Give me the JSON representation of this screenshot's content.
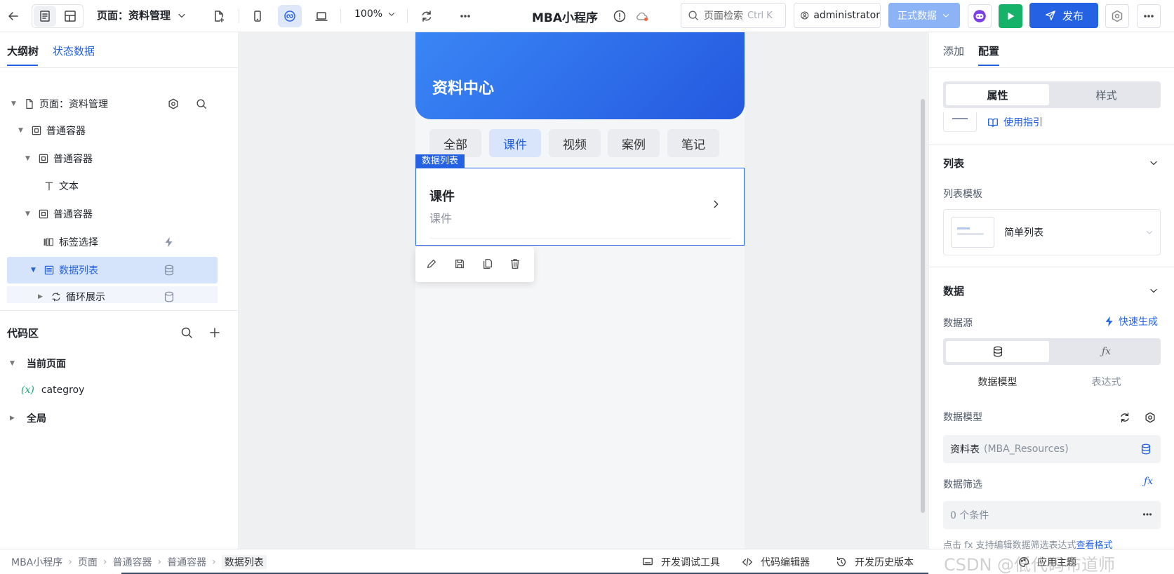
{
  "topbar": {
    "page_label": "页面：资料管理",
    "zoom": "100%",
    "app_title": "MBA小程序",
    "search_placeholder": "页面检索",
    "search_shortcut": "Ctrl K",
    "user": "administrator",
    "env_label": "正式数据",
    "publish_label": "发布"
  },
  "left": {
    "tabs": [
      "大纲树",
      "状态数据"
    ],
    "tree": [
      {
        "label": "页面：资料管理"
      },
      {
        "label": "普通容器"
      },
      {
        "label": "普通容器"
      },
      {
        "label": "文本"
      },
      {
        "label": "普通容器"
      },
      {
        "label": "标签选择"
      },
      {
        "label": "数据列表"
      },
      {
        "label": "循环展示"
      }
    ],
    "code_title": "代码区",
    "current_page": "当前页面",
    "variable": "categroy",
    "variable_prefix": "(x)",
    "global": "全局"
  },
  "canvas": {
    "header_title": "资料中心",
    "tags": [
      "全部",
      "课件",
      "视频",
      "案例",
      "笔记"
    ],
    "active_tag_index": 1,
    "selection_label": "数据列表",
    "item_title": "课件",
    "item_subtitle": "课件"
  },
  "right": {
    "tabs": [
      "添加",
      "配置"
    ],
    "seg": [
      "属性",
      "样式"
    ],
    "guide_link": "使用指引",
    "list_section": "列表",
    "list_template_label": "列表模板",
    "list_template_value": "简单列表",
    "data_section": "数据",
    "datasource_label": "数据源",
    "quick_gen": "快速生成",
    "source_options": [
      "数据模型",
      "表达式"
    ],
    "model_label": "数据模型",
    "model_value": "资料表",
    "model_value_sub": "(MBA_Resources)",
    "filter_label": "数据筛选",
    "filter_value": "0 个条件",
    "filter_hint": "点击 fx 支持编辑数据筛选表达式",
    "filter_hint_link": "查看格式"
  },
  "bottom": {
    "breadcrumb": [
      "MBA小程序",
      "页面",
      "普通容器",
      "普通容器",
      "数据列表"
    ],
    "tools": [
      "开发调试工具",
      "代码编辑器",
      "开发历史版本",
      "应用主题"
    ],
    "watermark": "CSDN @低代码布道师"
  }
}
